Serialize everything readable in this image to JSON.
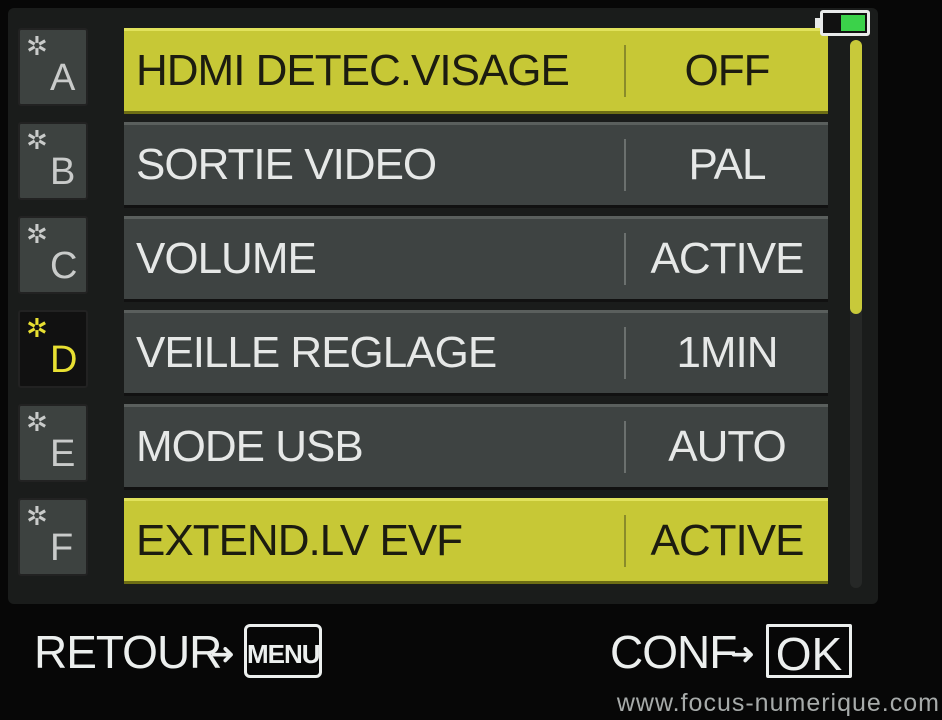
{
  "tabs": [
    {
      "letter": "A",
      "active": false
    },
    {
      "letter": "B",
      "active": false
    },
    {
      "letter": "C",
      "active": false
    },
    {
      "letter": "D",
      "active": true
    },
    {
      "letter": "E",
      "active": false
    },
    {
      "letter": "F",
      "active": false
    }
  ],
  "tab_symbol": "✲",
  "rows": [
    {
      "label": "HDMI DETEC.VISAGE",
      "value": "OFF",
      "highlight": true
    },
    {
      "label": "SORTIE VIDEO",
      "value": "PAL",
      "highlight": false
    },
    {
      "label": "VOLUME",
      "value": "ACTIVE",
      "highlight": false
    },
    {
      "label": "VEILLE REGLAGE",
      "value": "1MIN",
      "highlight": false
    },
    {
      "label": "MODE USB",
      "value": "AUTO",
      "highlight": false
    },
    {
      "label": "EXTEND.LV EVF",
      "value": "ACTIVE",
      "highlight": true
    }
  ],
  "scrollbar": {
    "position_fraction": 0.0,
    "visible_fraction": 0.5
  },
  "battery": {
    "level_fraction": 0.6,
    "color": "#3bd24a"
  },
  "footer": {
    "back_label": "RETOUR",
    "menu_key": "MENU",
    "confirm_label": "CONF",
    "ok_key": "OK",
    "arrow": "➜"
  },
  "watermark": "www.focus-numerique.com",
  "colors": {
    "highlight": "#c7c836",
    "active_tab_text": "#e8e032",
    "row_bg": "#3e4342"
  }
}
